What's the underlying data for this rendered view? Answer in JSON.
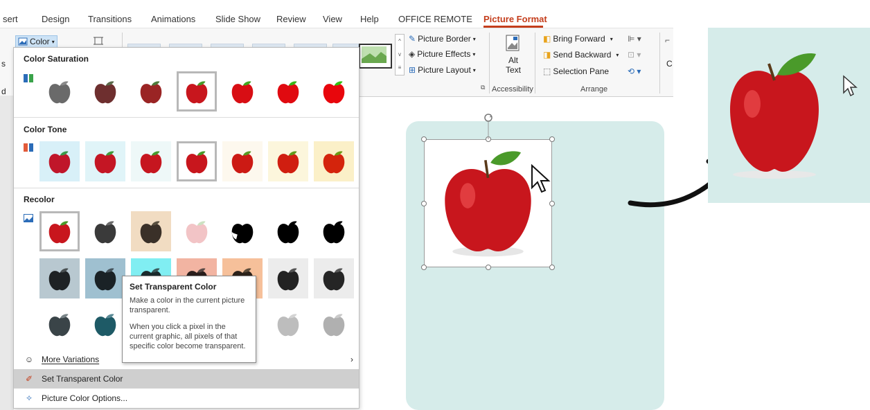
{
  "ribbon": {
    "tabs": [
      "sert",
      "Design",
      "Transitions",
      "Animations",
      "Slide Show",
      "Review",
      "View",
      "Help",
      "OFFICE REMOTE",
      "Picture Format"
    ],
    "color_button": "Color",
    "picture_border": "Picture Border",
    "picture_effects": "Picture Effects",
    "picture_layout": "Picture Layout",
    "alt_text_line1": "Alt",
    "alt_text_line2": "Text",
    "accessibility_label": "Accessibility",
    "bring_forward": "Bring Forward",
    "send_backward": "Send Backward",
    "selection_pane": "Selection Pane",
    "arrange_label": "Arrange",
    "crop_partial": "C",
    "left_partial_s": "s",
    "left_partial_d": "d"
  },
  "color_menu": {
    "sections": [
      {
        "title": "Color Saturation"
      },
      {
        "title": "Color Tone"
      },
      {
        "title": "Recolor"
      }
    ],
    "items": {
      "more_variations": "More Variations",
      "set_transparent": "Set Transparent Color",
      "picture_color_options": "Picture Color Options..."
    },
    "tooltip": {
      "title": "Set Transparent Color",
      "line1": "Make a color in the current picture transparent.",
      "line2": "When you click a pixel in the current graphic, all pixels of that specific color become transparent."
    }
  },
  "colors": {
    "accent": "#c43e1c",
    "slide_bg": "#d6ecea",
    "apple_red": "#c8161d",
    "leaf_green": "#4a9a2a"
  }
}
